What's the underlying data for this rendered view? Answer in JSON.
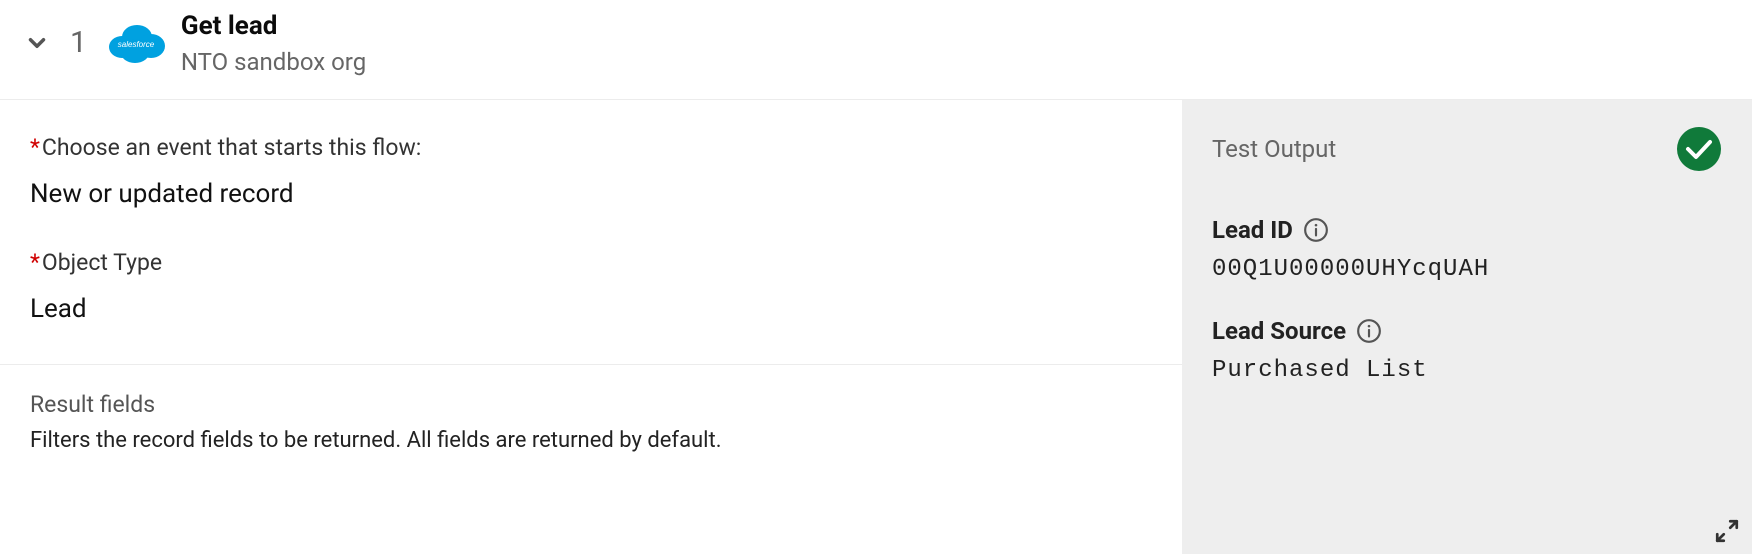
{
  "header": {
    "step_number": "1",
    "title": "Get lead",
    "subtitle": "NTO sandbox org",
    "sf_logo_text": "salesforce"
  },
  "form": {
    "event_label": "Choose an event that starts this flow:",
    "event_value": "New or updated record",
    "object_label": "Object Type",
    "object_value": "Lead"
  },
  "results": {
    "title": "Result fields",
    "description": "Filters the record fields to be returned. All fields are returned by default."
  },
  "sidebar": {
    "title": "Test Output",
    "outputs": {
      "lead_id": {
        "label": "Lead ID",
        "value": "00Q1U00000UHYcqUAH"
      },
      "lead_source": {
        "label": "Lead Source",
        "value": "Purchased List"
      }
    }
  }
}
